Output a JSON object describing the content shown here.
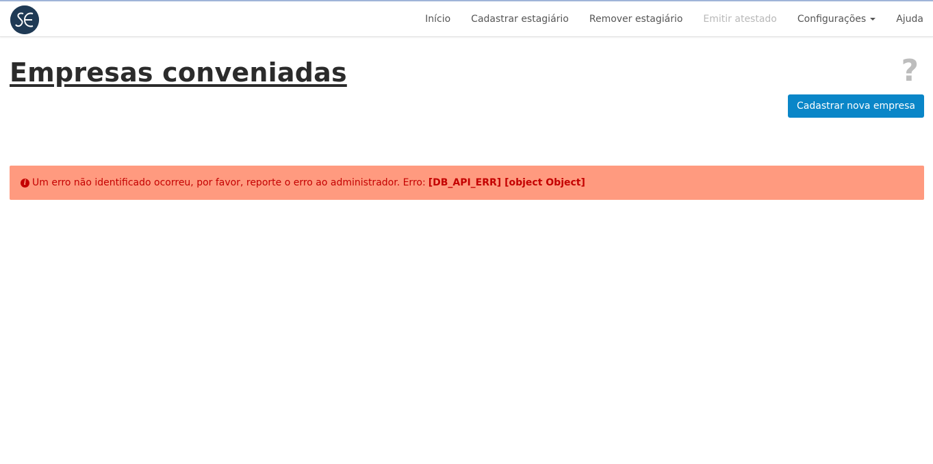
{
  "brand": {
    "logo_text": "SE",
    "logo_icon": "se-logo-icon",
    "bg_color": "#1f3a55"
  },
  "nav": {
    "items": [
      {
        "label": "Início"
      },
      {
        "label": "Cadastrar estagiário"
      },
      {
        "label": "Remover estagiário"
      },
      {
        "label": "Emitir atestado",
        "disabled": true
      },
      {
        "label": "Configurações",
        "has_dropdown": true
      },
      {
        "label": "Ajuda"
      }
    ]
  },
  "main": {
    "title": "Empresas conveniadas",
    "help_symbol": "?",
    "new_button_label": "Cadastrar nova empresa"
  },
  "alert": {
    "icon": "info-icon",
    "icon_symbol": "i",
    "message": "Um erro não identificado ocorreu, por favor, reporte o erro ao administrador. Erro:",
    "code": "[DB_API_ERR] [object Object]"
  },
  "colors": {
    "primary": "#0a86c8",
    "alert_bg": "#ff9a7f",
    "alert_text": "#c40000"
  }
}
